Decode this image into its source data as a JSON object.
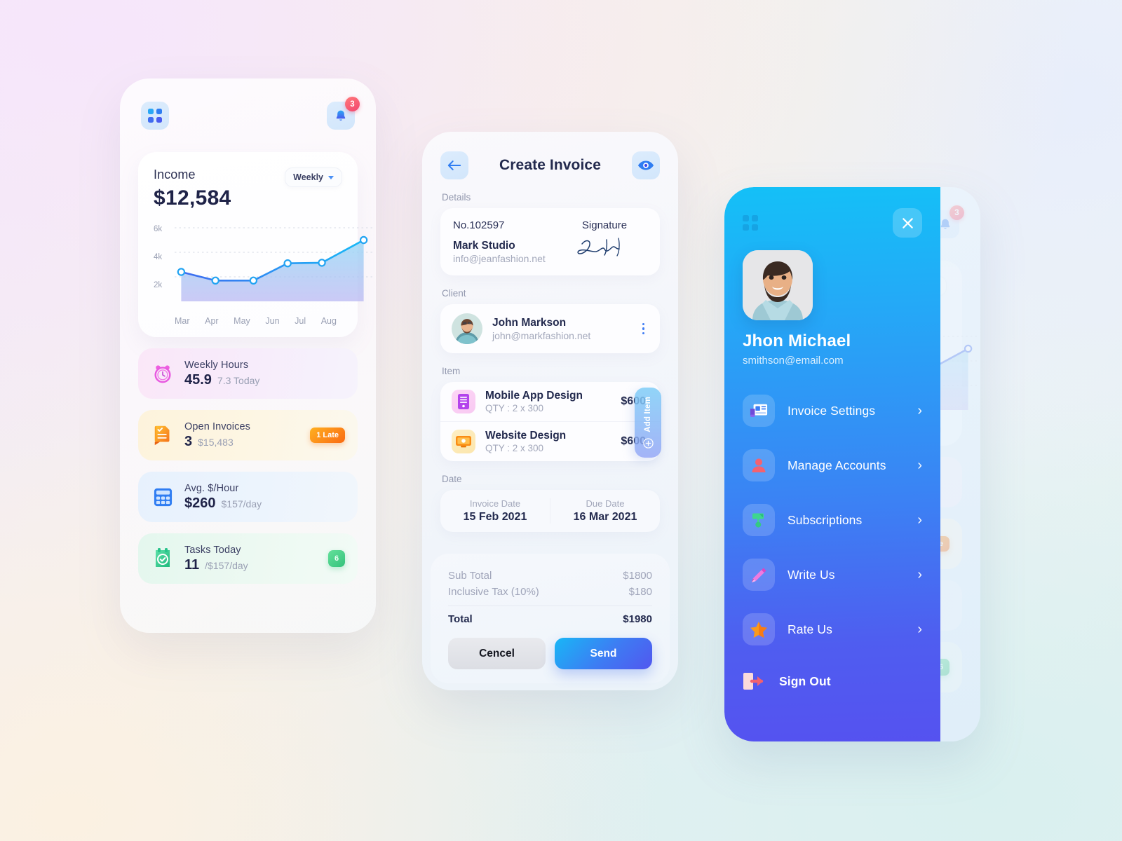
{
  "dashboard": {
    "grid_icon": "grid-apps-icon",
    "notification_icon": "bell-icon",
    "notification_count": "3",
    "income": {
      "title": "Income",
      "amount": "$12,584",
      "range_label": "Weekly",
      "range_caret": "chevron-down-icon"
    },
    "stats": [
      {
        "icon": "alarm-clock-icon",
        "label": "Weekly Hours",
        "value": "45.9",
        "sub": "7.3 Today",
        "badge": null
      },
      {
        "icon": "invoice-doc-icon",
        "label": "Open Invoices",
        "value": "3",
        "sub": "$15,483",
        "badge": "1 Late"
      },
      {
        "icon": "calculator-icon",
        "label": "Avg. $/Hour",
        "value": "$260",
        "sub": "$157/day",
        "badge": null
      },
      {
        "icon": "task-check-icon",
        "label": "Tasks Today",
        "value": "11",
        "sub": "/$157/day",
        "badge": "6"
      }
    ]
  },
  "chart_data": {
    "type": "area",
    "title": "Income",
    "categories": [
      "Mar",
      "Apr",
      "May",
      "Jun",
      "Jul",
      "Aug"
    ],
    "values": [
      2400,
      1700,
      1700,
      3100,
      3150,
      5000
    ],
    "points_x": [
      2,
      20,
      40,
      58,
      76,
      98
    ],
    "xlabel": "",
    "ylabel": "",
    "ylim": [
      0,
      6000
    ],
    "yticks": [
      "2k",
      "4k",
      "6k"
    ],
    "ytick_values": [
      2000,
      4000,
      6000
    ],
    "grid": true,
    "legend": "none",
    "line_color": "#2f9bf0",
    "marker_fill": "#ffffff",
    "area_top": "#8fd4f5",
    "area_bottom": "#b7b6f2"
  },
  "invoice": {
    "back_icon": "arrow-left-icon",
    "title": "Create Invoice",
    "preview_icon": "eye-icon",
    "sections": {
      "details": "Details",
      "client": "Client",
      "item": "Item",
      "date": "Date"
    },
    "details": {
      "number": "No.102597",
      "signature_label": "Signature",
      "org": "Mark Studio",
      "email": "info@jeanfashion.net",
      "signature_icon": "handwritten-signature"
    },
    "client": {
      "avatar": "client-avatar",
      "name": "John Markson",
      "email": "john@markfashion.net",
      "menu_icon": "kebab-menu-icon"
    },
    "items": [
      {
        "icon": "mobile-app-icon",
        "name": "Mobile App Design",
        "qty": "QTY : 2 x 300",
        "price": "$600"
      },
      {
        "icon": "website-icon",
        "name": "Website Design",
        "qty": "QTY : 2 x 300",
        "price": "$600"
      }
    ],
    "add_item": {
      "label": "Add Item",
      "icon": "plus-circle-icon"
    },
    "date": {
      "invoice_date_label": "Invoice Date",
      "invoice_date_value": "15 Feb 2021",
      "due_date_label": "Due Date",
      "due_date_value": "16 Mar 2021"
    },
    "totals": [
      {
        "label": "Sub Total",
        "value": "$1800"
      },
      {
        "label": "Inclusive Tax (10%)",
        "value": "$180"
      }
    ],
    "total": {
      "label": "Total",
      "value": "$1980"
    },
    "buttons": {
      "cancel": "Cencel",
      "send": "Send"
    }
  },
  "menu": {
    "close_icon": "close-icon",
    "grid_icon": "grid-apps-icon",
    "user": {
      "avatar": "user-avatar",
      "name": "Jhon Michael",
      "email": "smithson@email.com"
    },
    "items": [
      {
        "icon": "invoice-settings-icon",
        "label": "Invoice Settings",
        "chevron": "chevron-right-icon"
      },
      {
        "icon": "person-icon",
        "label": "Manage Accounts",
        "chevron": "chevron-right-icon"
      },
      {
        "icon": "subscriptions-icon",
        "label": "Subscriptions",
        "chevron": "chevron-right-icon"
      },
      {
        "icon": "pen-icon",
        "label": "Write Us",
        "chevron": "chevron-right-icon"
      },
      {
        "icon": "star-icon",
        "label": "Rate Us",
        "chevron": "chevron-right-icon"
      }
    ],
    "sign_out": {
      "icon": "sign-out-icon",
      "label": "Sign Out"
    }
  },
  "theme": {
    "accent_blue": "#3e7bf3",
    "accent_cyan": "#18b7f6",
    "accent_violet": "#5257ef",
    "badge_red": "#f2456f",
    "badge_orange": "#fa6a12",
    "badge_green": "#35c27c",
    "text_dark": "#232a4e",
    "text_muted": "#a3a8bb"
  }
}
